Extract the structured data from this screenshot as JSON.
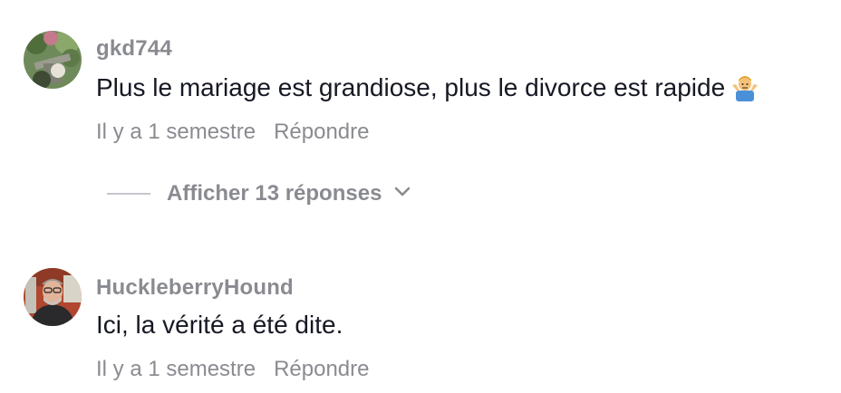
{
  "comments": [
    {
      "username": "gkd744",
      "text": "Plus le mariage est grandiose, plus le divorce est rapide",
      "emoji": "man-shrugging-emoji",
      "time": "Il y a 1 semestre",
      "reply_label": "Répondre",
      "view_replies_label": "Afficher 13 réponses"
    },
    {
      "username": "HuckleberryHound",
      "text": "Ici, la vérité a été dite.",
      "time": "Il y a 1 semestre",
      "reply_label": "Répondre"
    }
  ],
  "colors": {
    "secondary_text": "#8a8b91",
    "primary_text": "#161823",
    "divider": "#c6c7cb"
  }
}
